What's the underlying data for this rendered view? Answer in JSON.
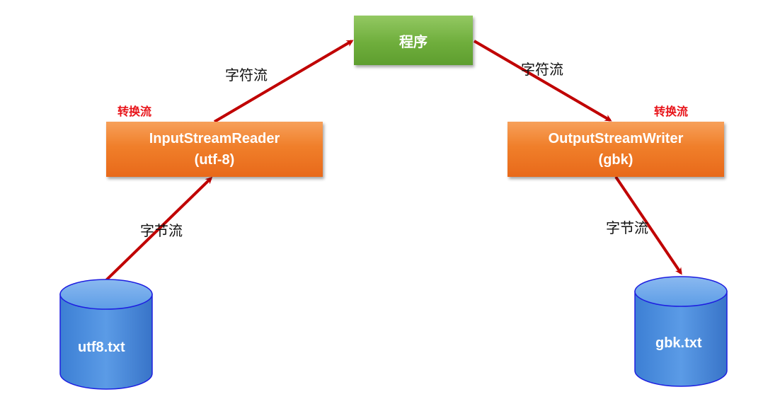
{
  "program": {
    "label": "程序"
  },
  "reader": {
    "name": "InputStreamReader",
    "charset": "(utf-8)"
  },
  "writer": {
    "name": "OutputStreamWriter",
    "charset": "(gbk)"
  },
  "conversion_labels": {
    "left": "转换流",
    "right": "转换流"
  },
  "stream_labels": {
    "left_char": "字符流",
    "right_char": "字符流",
    "left_byte": "字节流",
    "right_byte": "字节流"
  },
  "files": {
    "source": "utf8.txt",
    "target": "gbk.txt"
  },
  "colors": {
    "arrow": "#c00000",
    "process_box": "#f07f2a",
    "program_box": "#6fae3c",
    "cylinder": "#4b8ad8",
    "conversion_label": "#e8141a"
  }
}
